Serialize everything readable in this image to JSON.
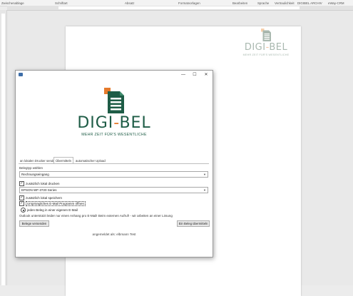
{
  "ribbon": {
    "groups": [
      "Zwischenablage",
      "Schriftart",
      "Absatz",
      "Formatvorlagen",
      "Bearbeiten",
      "Sprache",
      "Vertraulichkeit",
      "DIGIBEL ARCHIV",
      "eWay-CRM"
    ]
  },
  "page_logo": {
    "brand_left": "DIGI",
    "brand_dash": "-",
    "brand_right": "BEL",
    "tagline": "MEHR ZEIT FÜR'S WESENTLICHE"
  },
  "dialog": {
    "window_buttons": {
      "minimize": "—",
      "maximize": "☐",
      "close": "✕"
    },
    "logo": {
      "brand_left": "DIGI",
      "brand_dash": "-",
      "brand_right": "BEL",
      "tagline": "MEHR ZEIT FÜR'S WESENTLICHE"
    },
    "tabs": [
      {
        "label": "an lokalen Drucker senden"
      },
      {
        "label": "Übermitteln"
      },
      {
        "label": "automatischer Upload"
      }
    ],
    "belegtyp_label": "Belegtyp wählen",
    "belegtyp_value": "Rechnungseingang",
    "print_checkbox_label": "zusätzlich lokal drucken",
    "printer_value": "EPSON WF-3720 Series",
    "save_checkbox_label": "zusätzlich lokal speichern",
    "email_checkbox_label": "Ursprüngliches E-Mail Programm öffnen",
    "radio_label": "jeden Beleg in einer eigenen E-Mail",
    "info_text": "Outlook unterstützt leider nur einen Anhang pro E-Mail! Beim externen Aufruf! - wir arbeiten an einer Lösung",
    "left_button": "Belege versenden",
    "right_button": "Ein Beleg übermitteln",
    "footer_text": "angemeldet als: elbmann Test"
  },
  "colors": {
    "brand_green": "#1e5c46",
    "brand_orange": "#e57a2c"
  }
}
